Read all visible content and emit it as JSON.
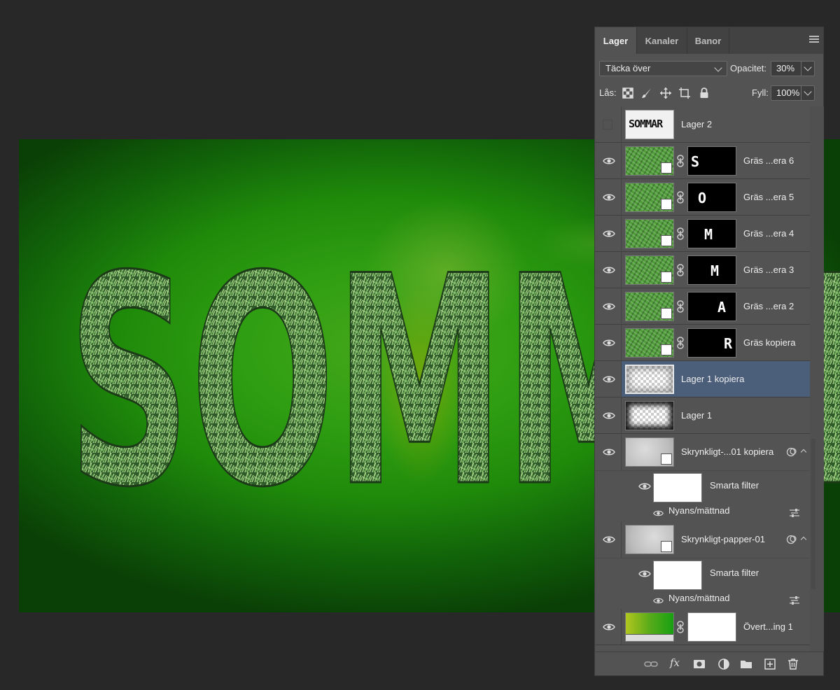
{
  "canvas": {
    "artwork_text": "SOMMAR"
  },
  "panel": {
    "tabs": [
      {
        "label": "Lager",
        "active": true
      },
      {
        "label": "Kanaler",
        "active": false
      },
      {
        "label": "Banor",
        "active": false
      }
    ],
    "blend_mode": "Täcka över",
    "opacity_label": "Opacitet:",
    "opacity_value": "30%",
    "lock_label": "Lås:",
    "fill_label": "Fyll:",
    "fill_value": "100%",
    "layers": [
      {
        "name": "Lager 2",
        "visible": false,
        "thumb_text": "SOMMAR"
      },
      {
        "name": "Gräs ...era 6",
        "visible": true,
        "mask_letter": "S"
      },
      {
        "name": "Gräs ...era 5",
        "visible": true,
        "mask_letter": "O"
      },
      {
        "name": "Gräs ...era 4",
        "visible": true,
        "mask_letter": "M"
      },
      {
        "name": "Gräs ...era 3",
        "visible": true,
        "mask_letter": "M"
      },
      {
        "name": "Gräs ...era 2",
        "visible": true,
        "mask_letter": "A"
      },
      {
        "name": "Gräs kopiera",
        "visible": true,
        "mask_letter": "R"
      },
      {
        "name": "Lager 1 kopiera",
        "visible": true,
        "selected": true
      },
      {
        "name": "Lager 1",
        "visible": true
      },
      {
        "name": "Skrynkligt-...01 kopiera",
        "visible": true,
        "smart_filter": "Smarta filter",
        "filter": "Nyans/mättnad"
      },
      {
        "name": "Skrynkligt-papper-01",
        "visible": true,
        "smart_filter": "Smarta filter",
        "filter": "Nyans/mättnad"
      },
      {
        "name": "Övert...ing 1",
        "visible": true
      }
    ],
    "footer_icons": [
      "link-layers-icon",
      "fx-icon",
      "add-mask-icon",
      "adjustment-layer-icon",
      "new-group-icon",
      "new-layer-icon",
      "trash-icon"
    ],
    "fx_label": "fx"
  },
  "colors": {
    "selected_row": "#4c5f7a",
    "panel_bg": "#535353",
    "app_bg": "#282828"
  }
}
